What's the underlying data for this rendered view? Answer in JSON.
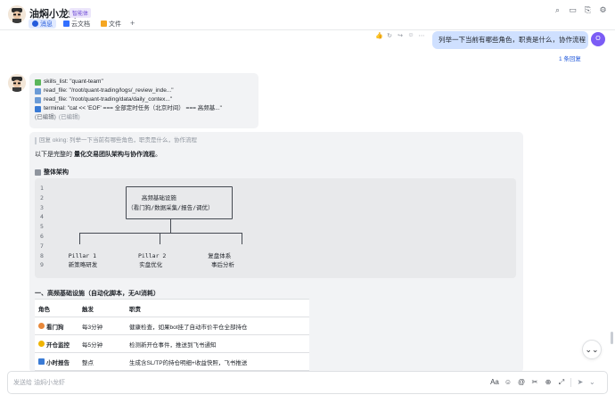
{
  "header": {
    "title": "油焖小龙虾",
    "badge": "智能体",
    "tabs": [
      {
        "label": "消息",
        "icon": "chat-bubble-icon",
        "color": "#245bdb"
      },
      {
        "label": "云文档",
        "icon": "cloud-doc-icon",
        "color": "#3370ff"
      },
      {
        "label": "文件",
        "icon": "folder-icon",
        "color": "#f5a623"
      }
    ],
    "add_tab": "+",
    "actions": [
      {
        "name": "search-icon",
        "glyph": "⌕"
      },
      {
        "name": "video-call-icon",
        "glyph": "▭"
      },
      {
        "name": "share-icon",
        "glyph": "⎘"
      },
      {
        "name": "settings-icon",
        "glyph": "⚙"
      }
    ]
  },
  "user_message": {
    "text": "列举一下当前有哪些角色，职责是什么，协作流程",
    "avatar_initial": "O",
    "reply_count": "1 条回复",
    "hover_actions": [
      "👍",
      "↻",
      "↪",
      "☺",
      "⋯"
    ]
  },
  "tool_message": {
    "lines": [
      {
        "icon_color": "#5bb65b",
        "text": "skills_list: \"quant-team\""
      },
      {
        "icon_color": "#6b9bd6",
        "text": "read_file: \"/root/quant-trading/logs/_review_inde...\""
      },
      {
        "icon_color": "#6b9bd6",
        "text": "read_file: \"/root/quant-trading/data/daily_contex...\""
      },
      {
        "icon_color": "#3a7bd5",
        "text": "terminal: \"cat << 'EOF' === 全部定时任务（北京时间） === 高频基...\""
      }
    ],
    "edited": "(已编辑)",
    "edited_muted": "(已编辑)"
  },
  "main_message": {
    "quote": "回复 oking: 列举一下当前有哪些角色，职责是什么，协作流程",
    "intro_prefix": "以下是完整的 ",
    "intro_bold": "量化交易团队架构与协作流程",
    "intro_suffix": "。",
    "arch_title": "整体架构",
    "code_lines": [
      {
        "n": "1",
        "t": ""
      },
      {
        "n": "2",
        "t": "                        高频基础设施"
      },
      {
        "n": "3",
        "t": "                    （看门狗/数据采集/报告/调优）"
      },
      {
        "n": "4",
        "t": ""
      },
      {
        "n": "5",
        "t": ""
      },
      {
        "n": "6",
        "t": ""
      },
      {
        "n": "7",
        "t": ""
      },
      {
        "n": "8",
        "t": "   Pillar 1            Pillar 2            复盘体系"
      },
      {
        "n": "9",
        "t": "   新策略研发            实盘优化              事后分析"
      }
    ],
    "section1_title": "一、高频基础设施（自动化脚本，无AI消耗）",
    "table": {
      "headers": [
        "角色",
        "触发",
        "职责"
      ],
      "rows": [
        {
          "role": "看门狗",
          "icon_color": "#e8883a",
          "trigger": "每3分钟",
          "duty": "健康检查，如果bot挂了自动市价平仓全部持仓"
        },
        {
          "role": "开仓监控",
          "icon_color": "#f0b400",
          "trigger": "每5分钟",
          "duty": "检测新开仓事件，推送到飞书通知"
        },
        {
          "role": "小时报告",
          "icon_color": "#3a7bd5",
          "trigger": "整点",
          "duty": "生成含SL/TP的持仓明细+收益快照，飞书推送"
        }
      ]
    }
  },
  "scroll_button": "⌄⌄",
  "input": {
    "placeholder": "发送给 油焖小龙虾",
    "tools": [
      {
        "name": "format-text-icon",
        "glyph": "Aa"
      },
      {
        "name": "emoji-icon",
        "glyph": "☺"
      },
      {
        "name": "mention-icon",
        "glyph": "@"
      },
      {
        "name": "screenshot-icon",
        "glyph": "✂"
      },
      {
        "name": "add-circle-icon",
        "glyph": "⊕"
      },
      {
        "name": "expand-icon",
        "glyph": "⤢"
      }
    ],
    "send_glyph": "➤",
    "more_glyph": "⌄"
  }
}
